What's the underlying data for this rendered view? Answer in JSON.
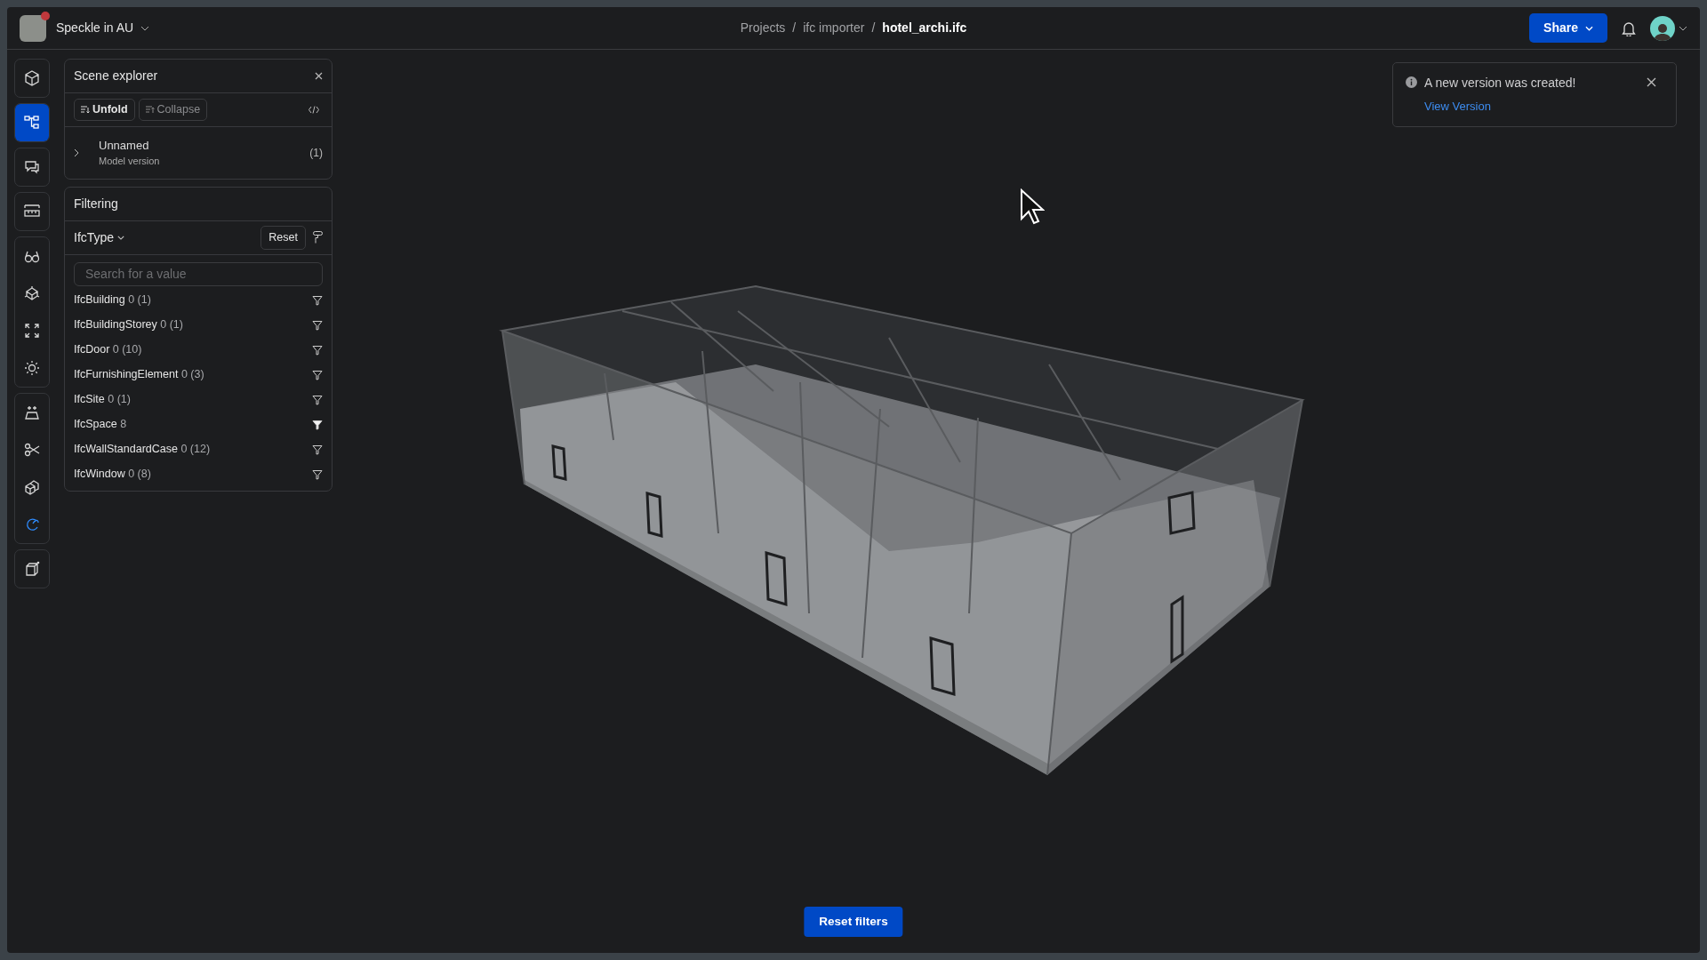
{
  "header": {
    "workspace": "Speckle in AU",
    "workspace_notification": true,
    "breadcrumbs": [
      {
        "label": "Projects",
        "current": false
      },
      {
        "label": "ifc importer",
        "current": false
      },
      {
        "label": "hotel_archi.ifc",
        "current": true
      }
    ],
    "breadcrumb_separators": [
      "/",
      "/"
    ],
    "share_button": "Share"
  },
  "toolbar": {
    "groups": [
      {
        "tools": [
          {
            "kind": "cube",
            "selected": false,
            "active": false
          }
        ]
      },
      {
        "tools": [
          {
            "kind": "tree",
            "selected": true,
            "active": false
          }
        ]
      },
      {
        "tools": [
          {
            "kind": "comments",
            "selected": false,
            "active": false
          }
        ]
      },
      {
        "tools": [
          {
            "kind": "ruler",
            "selected": false,
            "active": false
          }
        ]
      },
      {
        "tools": [
          {
            "kind": "glasses",
            "selected": false,
            "active": false
          },
          {
            "kind": "explode",
            "selected": false,
            "active": false
          },
          {
            "kind": "fit",
            "selected": false,
            "active": false
          },
          {
            "kind": "sun",
            "selected": false,
            "active": false
          }
        ]
      },
      {
        "tools": [
          {
            "kind": "isolate",
            "selected": false,
            "active": false
          },
          {
            "kind": "scissors",
            "selected": false,
            "active": false
          },
          {
            "kind": "boxes",
            "selected": false,
            "active": false
          },
          {
            "kind": "rotate",
            "selected": false,
            "active": true
          }
        ]
      },
      {
        "tools": [
          {
            "kind": "newbox",
            "selected": false,
            "active": false
          }
        ]
      }
    ]
  },
  "scene_explorer": {
    "title": "Scene explorer",
    "unfold": "Unfold",
    "collapse": "Collapse",
    "items": [
      {
        "name": "Unnamed",
        "subtitle": "Model version",
        "count": "(1)",
        "expanded": false
      }
    ]
  },
  "filtering": {
    "title": "Filtering",
    "property": "IfcType",
    "reset": "Reset",
    "search": {
      "placeholder": "Search for a value"
    },
    "items": [
      {
        "name": "IfcBuilding",
        "count": "0 (1)",
        "filtered": false
      },
      {
        "name": "IfcBuildingStorey",
        "count": "0 (1)",
        "filtered": false
      },
      {
        "name": "IfcDoor",
        "count": "0 (10)",
        "filtered": false
      },
      {
        "name": "IfcFurnishingElement",
        "count": "0 (3)",
        "filtered": false
      },
      {
        "name": "IfcSite",
        "count": "0 (1)",
        "filtered": false
      },
      {
        "name": "IfcSpace",
        "count": "8",
        "filtered": true
      },
      {
        "name": "IfcWallStandardCase",
        "count": "0 (12)",
        "filtered": false
      },
      {
        "name": "IfcWindow",
        "count": "0 (8)",
        "filtered": false
      }
    ]
  },
  "toast": {
    "message": "A new version was created!",
    "link": "View Version"
  },
  "reset_filters": "Reset filters"
}
